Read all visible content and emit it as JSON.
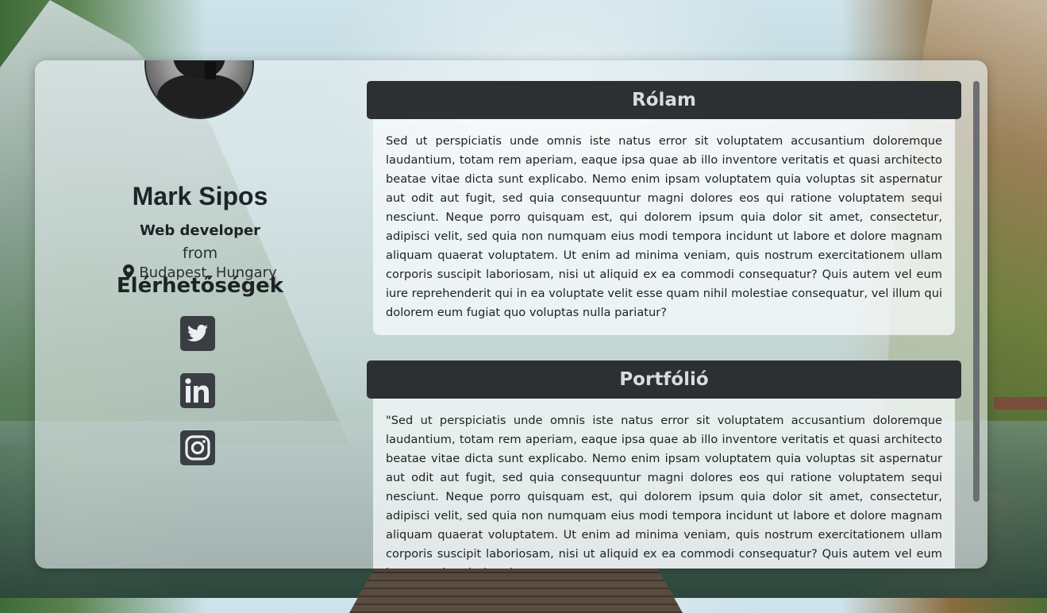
{
  "profile": {
    "name": "Mark Sipos",
    "job_title": "Web developer",
    "from_label": "from",
    "location": "Budapest, Hungary"
  },
  "contacts": {
    "title": "Elérhetőségek",
    "links": [
      {
        "icon": "twitter-icon"
      },
      {
        "icon": "linkedin-icon"
      },
      {
        "icon": "instagram-icon"
      }
    ]
  },
  "sections": [
    {
      "title": "Rólam",
      "text": "Sed ut perspiciatis unde omnis iste natus error sit voluptatem accusantium doloremque laudantium, totam rem aperiam, eaque ipsa quae ab illo inventore veritatis et quasi architecto beatae vitae dicta sunt explicabo. Nemo enim ipsam voluptatem quia voluptas sit aspernatur aut odit aut fugit, sed quia consequuntur magni dolores eos qui ratione voluptatem sequi nesciunt. Neque porro quisquam est, qui dolorem ipsum quia dolor sit amet, consectetur, adipisci velit, sed quia non numquam eius modi tempora incidunt ut labore et dolore magnam aliquam quaerat voluptatem. Ut enim ad minima veniam, quis nostrum exercitationem ullam corporis suscipit laboriosam, nisi ut aliquid ex ea commodi consequatur? Quis autem vel eum iure reprehenderit qui in ea voluptate velit esse quam nihil molestiae consequatur, vel illum qui dolorem eum fugiat quo voluptas nulla pariatur?"
    },
    {
      "title": "Portfólió",
      "text": "\"Sed ut perspiciatis unde omnis iste natus error sit voluptatem accusantium doloremque laudantium, totam rem aperiam, eaque ipsa quae ab illo inventore veritatis et quasi architecto beatae vitae dicta sunt explicabo. Nemo enim ipsam voluptatem quia voluptas sit aspernatur aut odit aut fugit, sed quia consequuntur magni dolores eos qui ratione voluptatem sequi nesciunt. Neque porro quisquam est, qui dolorem ipsum quia dolor sit amet, consectetur, adipisci velit, sed quia non numquam eius modi tempora incidunt ut labore et dolore magnam aliquam quaerat voluptatem. Ut enim ad minima veniam, quis nostrum exercitationem ullam corporis suscipit laboriosam, nisi ut aliquid ex ea commodi consequatur? Quis autem vel eum iure reprehenderit qui"
    }
  ],
  "colors": {
    "header_bg": "#2d3033",
    "header_text": "#d8dcdf",
    "card_bg": "rgba(232,240,242,0.62)"
  }
}
